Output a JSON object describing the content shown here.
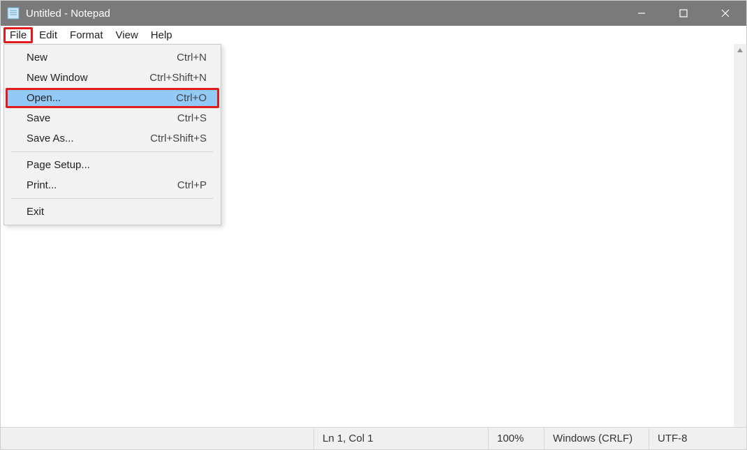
{
  "window": {
    "title": "Untitled - Notepad"
  },
  "menubar": {
    "items": [
      {
        "label": "File"
      },
      {
        "label": "Edit"
      },
      {
        "label": "Format"
      },
      {
        "label": "View"
      },
      {
        "label": "Help"
      }
    ]
  },
  "file_menu": {
    "items": [
      {
        "label": "New",
        "shortcut": "Ctrl+N"
      },
      {
        "label": "New Window",
        "shortcut": "Ctrl+Shift+N"
      },
      {
        "label": "Open...",
        "shortcut": "Ctrl+O",
        "highlighted": true
      },
      {
        "label": "Save",
        "shortcut": "Ctrl+S"
      },
      {
        "label": "Save As...",
        "shortcut": "Ctrl+Shift+S"
      }
    ],
    "items2": [
      {
        "label": "Page Setup...",
        "shortcut": ""
      },
      {
        "label": "Print...",
        "shortcut": "Ctrl+P"
      }
    ],
    "items3": [
      {
        "label": "Exit",
        "shortcut": ""
      }
    ]
  },
  "statusbar": {
    "position": "Ln 1, Col 1",
    "zoom": "100%",
    "line_ending": "Windows (CRLF)",
    "encoding": "UTF-8"
  }
}
